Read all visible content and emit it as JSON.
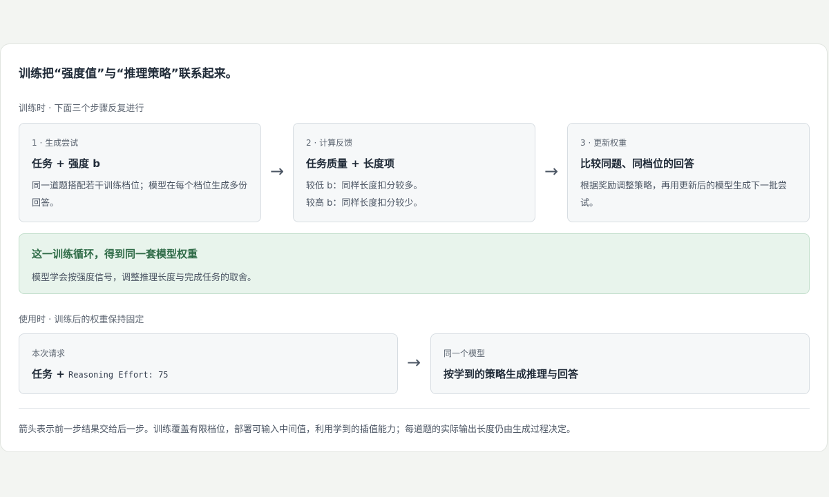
{
  "title": "训练把“强度值”与“推理策略”联系起来。",
  "training": {
    "label": "训练时 · 下面三个步骤反复进行",
    "steps": [
      {
        "tag": "1 · 生成尝试",
        "heading": "任务 + 强度 b",
        "body": [
          "同一道题搭配若干训练档位；模型在每个档位生成多份",
          "回答。"
        ]
      },
      {
        "tag": "2 · 计算反馈",
        "heading": "任务质量 + 长度项",
        "body": [
          "较低 b：同样长度扣分较多。",
          "较高 b：同样长度扣分较少。"
        ]
      },
      {
        "tag": "3 · 更新权重",
        "heading": "比较同题、同档位的回答",
        "body": [
          "根据奖励调整策略，再用更新后的模型生成下一批尝",
          "试。"
        ]
      }
    ],
    "arrow": "→"
  },
  "loop": {
    "heading": "这一训练循环，得到同一套模型权重",
    "body": "模型学会按强度信号，调整推理长度与完成任务的取舍。"
  },
  "usage": {
    "label": "使用时 · 训练后的权重保持固定",
    "request": {
      "tag": "本次请求",
      "heading_prefix": "任务 +",
      "heading_code": "Reasoning Effort: 75"
    },
    "model": {
      "tag": "同一个模型",
      "heading": "按学到的策略生成推理与回答"
    },
    "arrow": "→"
  },
  "footnote": "箭头表示前一步结果交给后一步。训练覆盖有限档位，部署可输入中间值，利用学到的插值能力；每道题的实际输出长度仍由生成过程决定。",
  "colors": {
    "background": "#f3f5f2",
    "card": "#f6f8f9",
    "loop_fill": "#e8f4ec",
    "loop_heading": "#2f6b47"
  }
}
